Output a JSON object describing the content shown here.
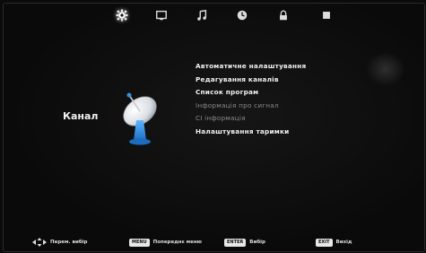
{
  "top_tabs": [
    {
      "icon": "gear-icon",
      "active": true
    },
    {
      "icon": "picture-icon",
      "active": false
    },
    {
      "icon": "music-note-icon",
      "active": false
    },
    {
      "icon": "clock-icon",
      "active": false
    },
    {
      "icon": "lock-icon",
      "active": false
    },
    {
      "icon": "square-icon",
      "active": false
    }
  ],
  "section": {
    "title": "Канал",
    "icon": "satellite-dish-icon"
  },
  "menu": [
    {
      "label": "Автоматичне налаштування",
      "enabled": true
    },
    {
      "label": "Редагування каналів",
      "enabled": true
    },
    {
      "label": "Список програм",
      "enabled": true
    },
    {
      "label": "Інформація про сигнал",
      "enabled": false
    },
    {
      "label": "CI інформація",
      "enabled": false
    },
    {
      "label": "Налаштування таримки",
      "enabled": true
    }
  ],
  "hints": [
    {
      "key": "",
      "label": "Перем. вибір",
      "icon": "arrows-icon"
    },
    {
      "key": "MENU",
      "label": "Попереднє меню"
    },
    {
      "key": "ENTER",
      "label": "Вибір"
    },
    {
      "key": "EXIT",
      "label": "Вихід"
    }
  ],
  "colors": {
    "background": "#0b0b0b",
    "text": "#f2f2f2",
    "dim_text": "#8a8a8a",
    "dish_blue": "#2a8fe0"
  }
}
